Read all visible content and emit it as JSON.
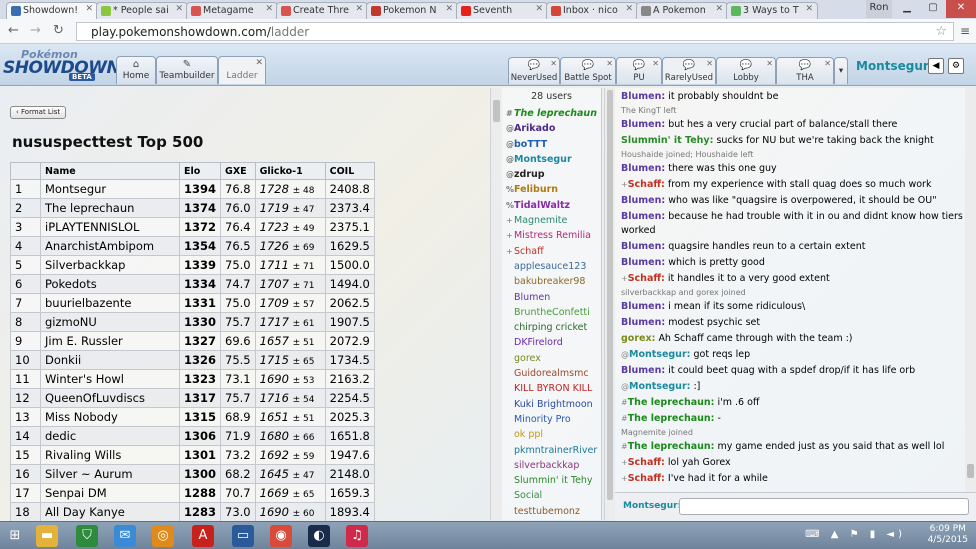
{
  "browser": {
    "tabs": [
      {
        "title": "Showdown!",
        "color": "#3b6fb3",
        "active": true
      },
      {
        "title": "* People sai",
        "color": "#8cc63f"
      },
      {
        "title": "Metagame",
        "color": "#d9534f"
      },
      {
        "title": "Create Thre",
        "color": "#d9534f"
      },
      {
        "title": "Pokemon N",
        "color": "#c0392b"
      },
      {
        "title": "Seventh",
        "color": "#e62117"
      },
      {
        "title": "Inbox · nico",
        "color": "#d44638"
      },
      {
        "title": "A Pokemon",
        "color": "#888888"
      },
      {
        "title": "3 Ways to T",
        "color": "#5cb85c"
      }
    ],
    "user_badge": "Ron",
    "url_host": "play.pokemonshowdown.com/",
    "url_path": "ladder"
  },
  "ps": {
    "logo_top": "Pokémon",
    "logo_main": "SHOWDOWN",
    "logo_badge": "BETA",
    "main_tabs": [
      {
        "label": "Home",
        "icon": "⌂"
      },
      {
        "label": "Teambuilder",
        "icon": "✎"
      },
      {
        "label": "Ladder",
        "icon": "",
        "current": true
      }
    ],
    "room_tabs": [
      {
        "label": "NeverUsed"
      },
      {
        "label": "Battle Spot"
      },
      {
        "label": "PU"
      },
      {
        "label": "RarelyUsed",
        "current": true
      },
      {
        "label": "Lobby"
      },
      {
        "label": "THA"
      }
    ],
    "username": "Montsegur",
    "sound_icon": "◀",
    "options_icon": "⚙"
  },
  "ladder": {
    "format_button": "Format List",
    "title": "nususpecttest Top 500",
    "headers": [
      "",
      "Name",
      "Elo",
      "GXE",
      "Glicko-1",
      "COIL"
    ],
    "rows": [
      {
        "rank": "1",
        "name": "Montsegur",
        "elo": "1394",
        "gxe": "76.8",
        "glicko": "1728",
        "dev": "± 48",
        "coil": "2408.8"
      },
      {
        "rank": "2",
        "name": "The leprechaun",
        "elo": "1374",
        "gxe": "76.0",
        "glicko": "1719",
        "dev": "± 47",
        "coil": "2373.4"
      },
      {
        "rank": "3",
        "name": "iPLAYTENNISLOL",
        "elo": "1372",
        "gxe": "76.4",
        "glicko": "1723",
        "dev": "± 49",
        "coil": "2375.1"
      },
      {
        "rank": "4",
        "name": "AnarchistAmbipom",
        "elo": "1354",
        "gxe": "76.5",
        "glicko": "1726",
        "dev": "± 69",
        "coil": "1629.5"
      },
      {
        "rank": "5",
        "name": "Silverbackkap",
        "elo": "1339",
        "gxe": "75.0",
        "glicko": "1711",
        "dev": "± 71",
        "coil": "1500.0"
      },
      {
        "rank": "6",
        "name": "Pokedots",
        "elo": "1334",
        "gxe": "74.7",
        "glicko": "1707",
        "dev": "± 71",
        "coil": "1494.0"
      },
      {
        "rank": "7",
        "name": "buurielbazente",
        "elo": "1331",
        "gxe": "75.0",
        "glicko": "1709",
        "dev": "± 57",
        "coil": "2062.5"
      },
      {
        "rank": "8",
        "name": "gizmoNU",
        "elo": "1330",
        "gxe": "75.7",
        "glicko": "1717",
        "dev": "± 61",
        "coil": "1907.5"
      },
      {
        "rank": "9",
        "name": "Jim E. Russler",
        "elo": "1327",
        "gxe": "69.6",
        "glicko": "1657",
        "dev": "± 51",
        "coil": "2072.9"
      },
      {
        "rank": "10",
        "name": "Donkii",
        "elo": "1326",
        "gxe": "75.5",
        "glicko": "1715",
        "dev": "± 65",
        "coil": "1734.5"
      },
      {
        "rank": "11",
        "name": "Winter's Howl",
        "elo": "1323",
        "gxe": "73.1",
        "glicko": "1690",
        "dev": "± 53",
        "coil": "2163.2"
      },
      {
        "rank": "12",
        "name": "QueenOfLuvdiscs",
        "elo": "1317",
        "gxe": "75.7",
        "glicko": "1716",
        "dev": "± 54",
        "coil": "2254.5"
      },
      {
        "rank": "13",
        "name": "Miss Nobody",
        "elo": "1315",
        "gxe": "68.9",
        "glicko": "1651",
        "dev": "± 51",
        "coil": "2025.3"
      },
      {
        "rank": "14",
        "name": "dedic",
        "elo": "1306",
        "gxe": "71.9",
        "glicko": "1680",
        "dev": "± 66",
        "coil": "1651.8"
      },
      {
        "rank": "15",
        "name": "Rivaling Wills",
        "elo": "1301",
        "gxe": "73.2",
        "glicko": "1692",
        "dev": "± 59",
        "coil": "1947.6"
      },
      {
        "rank": "16",
        "name": "Silver ~ Aurum",
        "elo": "1300",
        "gxe": "68.2",
        "glicko": "1645",
        "dev": "± 47",
        "coil": "2148.0"
      },
      {
        "rank": "17",
        "name": "Senpai DM",
        "elo": "1288",
        "gxe": "70.7",
        "glicko": "1669",
        "dev": "± 65",
        "coil": "1659.3"
      },
      {
        "rank": "18",
        "name": "All Day Kanye",
        "elo": "1283",
        "gxe": "73.0",
        "glicko": "1690",
        "dev": "± 60",
        "coil": "1893.4"
      }
    ]
  },
  "userlist": {
    "count": "28 users",
    "users": [
      {
        "rank": "#",
        "name": "The leprechaun",
        "color": "#1a8a1a",
        "bold": true,
        "italic": true
      },
      {
        "rank": "@",
        "name": "Arikado",
        "color": "#4b2a8a",
        "bold": true
      },
      {
        "rank": "@",
        "name": "boTTT",
        "color": "#1f5fb0",
        "bold": true
      },
      {
        "rank": "@",
        "name": "Montsegur",
        "color": "#1a8a9e",
        "bold": true
      },
      {
        "rank": "@",
        "name": "zdrup",
        "color": "#222222",
        "bold": true
      },
      {
        "rank": "%",
        "name": "Feliburn",
        "color": "#b07a10",
        "bold": true
      },
      {
        "rank": "%",
        "name": "TidalWaltz",
        "color": "#8a2aa8",
        "bold": true
      },
      {
        "rank": "+",
        "name": "Magnemite",
        "color": "#2a8a6a"
      },
      {
        "rank": "+",
        "name": "Mistress Remilia",
        "color": "#b02a7a"
      },
      {
        "rank": "+",
        "name": "Schaff",
        "color": "#c03020"
      },
      {
        "rank": "",
        "name": "applesauce123",
        "color": "#3a6a9a"
      },
      {
        "rank": "",
        "name": "bakubreaker98",
        "color": "#8a6a2a"
      },
      {
        "rank": "",
        "name": "Blumen",
        "color": "#5a3aa0"
      },
      {
        "rank": "",
        "name": "BruntheConfetti",
        "color": "#4a9a3a"
      },
      {
        "rank": "",
        "name": "chirping cricket",
        "color": "#2a6a2a"
      },
      {
        "rank": "",
        "name": "DKFirelord",
        "color": "#6a2aa8"
      },
      {
        "rank": "",
        "name": "gorex",
        "color": "#7a8a1a"
      },
      {
        "rank": "",
        "name": "Guidorealmsmc",
        "color": "#9a4a2a"
      },
      {
        "rank": "",
        "name": "KILL BYRON KILL",
        "color": "#c02020"
      },
      {
        "rank": "",
        "name": "Kuki Brightmoon",
        "color": "#2a4aa0"
      },
      {
        "rank": "",
        "name": "Minority Pro",
        "color": "#2a5ab0"
      },
      {
        "rank": "",
        "name": "ok ppl",
        "color": "#c09a10"
      },
      {
        "rank": "",
        "name": "pkmntrainerRiver",
        "color": "#1a7a9a"
      },
      {
        "rank": "",
        "name": "silverbackkap",
        "color": "#8a3a7a"
      },
      {
        "rank": "",
        "name": "Slummin' it Tehy",
        "color": "#2a8a2a"
      },
      {
        "rank": "",
        "name": "Social",
        "color": "#3a8a4a"
      },
      {
        "rank": "",
        "name": "testtubemonz",
        "color": "#8a5a2a"
      }
    ]
  },
  "chat": {
    "messages": [
      {
        "type": "msg",
        "rank": "",
        "name": "Blumen",
        "color": "#5a3aa0",
        "text": "it probably shouldnt be"
      },
      {
        "type": "notice",
        "text": "The KingT left"
      },
      {
        "type": "msg",
        "rank": "",
        "name": "Blumen",
        "color": "#5a3aa0",
        "text": "but hes a very crucial part of balance/stall there"
      },
      {
        "type": "msg",
        "rank": "",
        "name": "Slummin' it Tehy",
        "color": "#2a8a2a",
        "text": "sucks for NU but we're taking back the knight"
      },
      {
        "type": "notice",
        "text": "Houshaide joined; Houshaide left"
      },
      {
        "type": "msg",
        "rank": "",
        "name": "Blumen",
        "color": "#5a3aa0",
        "text": "there was this one guy"
      },
      {
        "type": "msg",
        "rank": "+",
        "name": "Schaff",
        "color": "#c03020",
        "text": "from my experience with stall quag does so much work"
      },
      {
        "type": "msg",
        "rank": "",
        "name": "Blumen",
        "color": "#5a3aa0",
        "text": "who was like \"quagsire is overpowered, it should be OU\""
      },
      {
        "type": "msg",
        "rank": "",
        "name": "Blumen",
        "color": "#5a3aa0",
        "text": "because he had trouble with it in ou and didnt know how tiers worked"
      },
      {
        "type": "msg",
        "rank": "",
        "name": "Blumen",
        "color": "#5a3aa0",
        "text": "quagsire handles reun to a certain extent"
      },
      {
        "type": "msg",
        "rank": "",
        "name": "Blumen",
        "color": "#5a3aa0",
        "text": "which is pretty good"
      },
      {
        "type": "msg",
        "rank": "+",
        "name": "Schaff",
        "color": "#c03020",
        "text": "it handles it to a very good extent"
      },
      {
        "type": "notice",
        "text": "silverbackkap and gorex joined"
      },
      {
        "type": "msg",
        "rank": "",
        "name": "Blumen",
        "color": "#5a3aa0",
        "text": "i mean if its some ridiculous\\"
      },
      {
        "type": "msg",
        "rank": "",
        "name": "Blumen",
        "color": "#5a3aa0",
        "text": "modest psychic set"
      },
      {
        "type": "msg",
        "rank": "",
        "name": "gorex",
        "color": "#7a8a1a",
        "text": "Ah Schaff came through with the team :)"
      },
      {
        "type": "msg",
        "rank": "@",
        "name": "Montsegur",
        "color": "#1a8a9e",
        "text": "got reqs lep"
      },
      {
        "type": "msg",
        "rank": "",
        "name": "Blumen",
        "color": "#5a3aa0",
        "text": "it could beet quag with a spdef drop/if it has life orb"
      },
      {
        "type": "msg",
        "rank": "@",
        "name": "Montsegur",
        "color": "#1a8a9e",
        "text": ":]"
      },
      {
        "type": "msg",
        "rank": "#",
        "name": "The leprechaun",
        "color": "#1a8a1a",
        "text": "i'm .6 off"
      },
      {
        "type": "msg",
        "rank": "#",
        "name": "The leprechaun",
        "color": "#1a8a1a",
        "text": "-"
      },
      {
        "type": "notice",
        "text": "Magnemite joined"
      },
      {
        "type": "msg",
        "rank": "#",
        "name": "The leprechaun",
        "color": "#1a8a1a",
        "text": "my game ended just as you said that as well lol"
      },
      {
        "type": "msg",
        "rank": "+",
        "name": "Schaff",
        "color": "#c03020",
        "text": "lol yah Gorex"
      },
      {
        "type": "msg",
        "rank": "+",
        "name": "Schaff",
        "color": "#c03020",
        "text": "I've had it for a while"
      }
    ],
    "input_name": "Montsegur:",
    "input_placeholder": ""
  },
  "taskbar": {
    "apps": [
      {
        "name": "windows-start-icon",
        "glyph": "⊞",
        "color": "transparent"
      },
      {
        "name": "file-explorer-icon",
        "glyph": "▬",
        "color": "#e3b23c"
      },
      {
        "name": "store-icon",
        "glyph": "⛉",
        "color": "#2e8b3e"
      },
      {
        "name": "mail-icon",
        "glyph": "✉",
        "color": "#3a8ad6"
      },
      {
        "name": "audio-app-icon",
        "glyph": "◎",
        "color": "#e08a1a"
      },
      {
        "name": "adobe-icon",
        "glyph": "A",
        "color": "#c8201a"
      },
      {
        "name": "lenovo-icon",
        "glyph": "▭",
        "color": "#2a5a9a"
      },
      {
        "name": "chrome-icon",
        "glyph": "◉",
        "color": "#d84a3a"
      },
      {
        "name": "steam-icon",
        "glyph": "◐",
        "color": "#1a2a4a"
      },
      {
        "name": "itunes-icon",
        "glyph": "♫",
        "color": "#d02a4a"
      }
    ],
    "time": "6:09 PM",
    "date": "4/5/2015"
  }
}
